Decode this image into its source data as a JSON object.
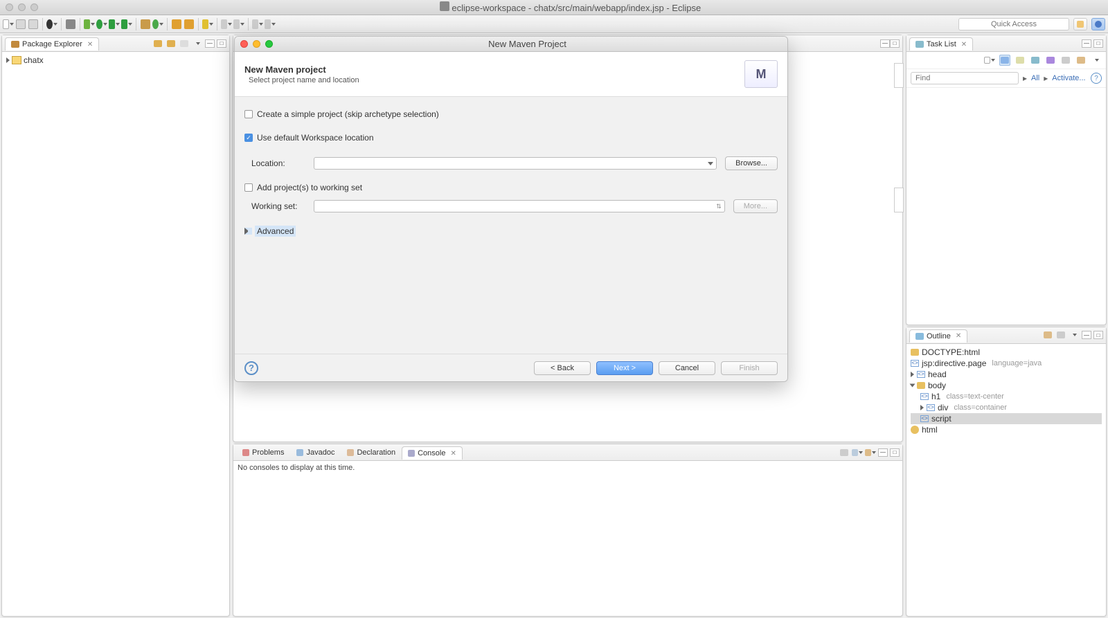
{
  "titlebar": {
    "title": "eclipse-workspace - chatx/src/main/webapp/index.jsp - Eclipse"
  },
  "quick_access": {
    "placeholder": "Quick Access"
  },
  "package_explorer": {
    "tab": "Package Explorer",
    "items": [
      "chatx"
    ]
  },
  "task_list": {
    "tab": "Task List",
    "find_placeholder": "Find",
    "all": "All",
    "activate": "Activate..."
  },
  "outline": {
    "tab": "Outline",
    "nodes": {
      "doctype": "DOCTYPE:html",
      "directive": "jsp:directive.page",
      "directive_attr": "language=java",
      "head": "head",
      "body": "body",
      "h1": "h1",
      "h1_attr": "class=text-center",
      "div": "div",
      "div_attr": "class=container",
      "script": "script",
      "html": "html"
    }
  },
  "bottom": {
    "tabs": {
      "problems": "Problems",
      "javadoc": "Javadoc",
      "declaration": "Declaration",
      "console": "Console"
    },
    "msg": "No consoles to display at this time."
  },
  "dialog": {
    "title": "New Maven Project",
    "heading": "New Maven project",
    "sub": "Select project name and location",
    "chk_simple": "Create a simple project (skip archetype selection)",
    "chk_default": "Use default Workspace location",
    "location_label": "Location:",
    "browse": "Browse...",
    "chk_workingset": "Add project(s) to working set",
    "workingset_label": "Working set:",
    "more": "More...",
    "advanced": "Advanced",
    "back": "< Back",
    "next": "Next >",
    "cancel": "Cancel",
    "finish": "Finish"
  }
}
